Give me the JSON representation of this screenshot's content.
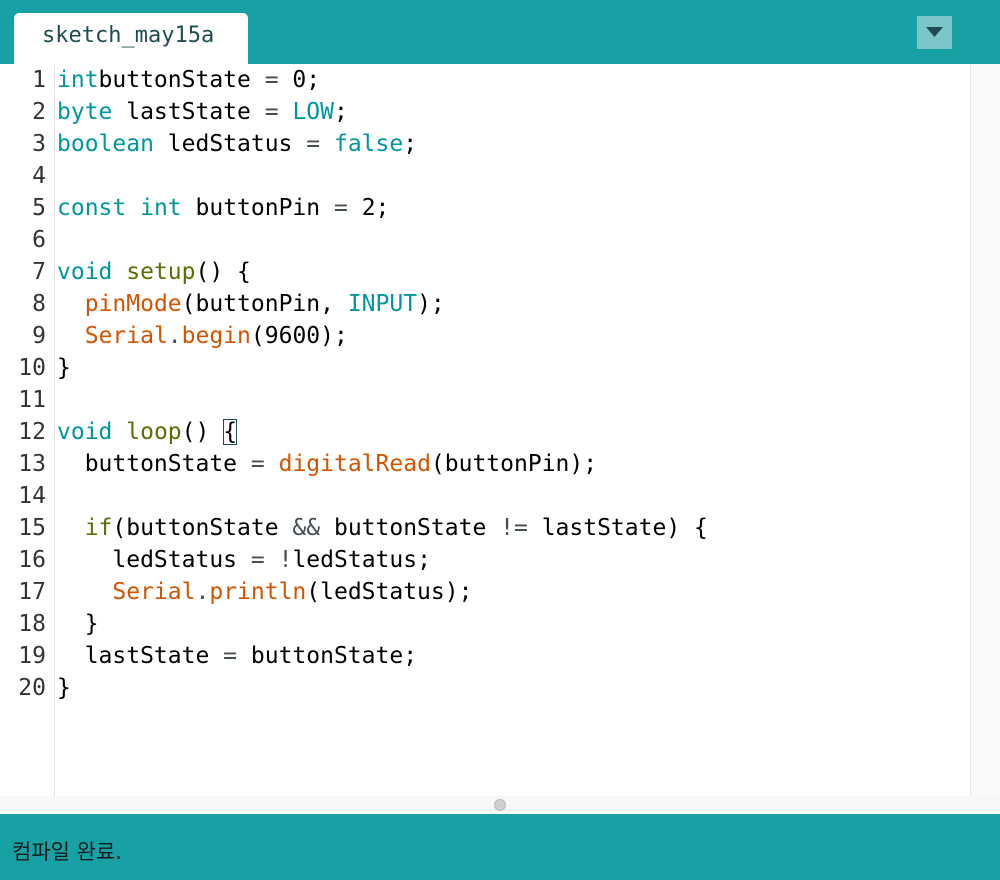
{
  "tab": {
    "label": "sketch_may15a"
  },
  "menu": {
    "icon": "triangle-down-icon"
  },
  "code": {
    "lines": [
      {
        "n": "1",
        "tokens": [
          [
            "kw",
            "int"
          ],
          [
            "",
            "buttonState "
          ],
          [
            "op",
            "="
          ],
          [
            "",
            " 0;"
          ]
        ]
      },
      {
        "n": "2",
        "tokens": [
          [
            "kw",
            "byte"
          ],
          [
            "",
            " lastState "
          ],
          [
            "op",
            "="
          ],
          [
            "",
            " "
          ],
          [
            "kw",
            "LOW"
          ],
          [
            "",
            ";"
          ]
        ]
      },
      {
        "n": "3",
        "tokens": [
          [
            "kw",
            "boolean"
          ],
          [
            "",
            " ledStatus "
          ],
          [
            "op",
            "="
          ],
          [
            "",
            " "
          ],
          [
            "kw",
            "false"
          ],
          [
            "",
            ";"
          ]
        ]
      },
      {
        "n": "4",
        "tokens": []
      },
      {
        "n": "5",
        "tokens": [
          [
            "kw",
            "const"
          ],
          [
            "",
            " "
          ],
          [
            "kw",
            "int"
          ],
          [
            "",
            " buttonPin "
          ],
          [
            "op",
            "="
          ],
          [
            "",
            " 2;"
          ]
        ]
      },
      {
        "n": "6",
        "tokens": []
      },
      {
        "n": "7",
        "tokens": [
          [
            "kw",
            "void"
          ],
          [
            "",
            " "
          ],
          [
            "fn",
            "setup"
          ],
          [
            "",
            "() {"
          ]
        ]
      },
      {
        "n": "8",
        "tokens": [
          [
            "",
            "  "
          ],
          [
            "ard",
            "pinMode"
          ],
          [
            "",
            "(buttonPin, "
          ],
          [
            "kw",
            "INPUT"
          ],
          [
            "",
            ");"
          ]
        ]
      },
      {
        "n": "9",
        "tokens": [
          [
            "",
            "  "
          ],
          [
            "ard",
            "Serial"
          ],
          [
            "op",
            "."
          ],
          [
            "ard",
            "begin"
          ],
          [
            "",
            "(9600);"
          ]
        ]
      },
      {
        "n": "10",
        "tokens": [
          [
            "",
            "}"
          ]
        ]
      },
      {
        "n": "11",
        "tokens": []
      },
      {
        "n": "12",
        "tokens": [
          [
            "kw",
            "void"
          ],
          [
            "",
            " "
          ],
          [
            "fn",
            "loop"
          ],
          [
            "",
            "() "
          ],
          [
            "cursor",
            "{"
          ]
        ]
      },
      {
        "n": "13",
        "tokens": [
          [
            "",
            "  buttonState "
          ],
          [
            "op",
            "="
          ],
          [
            "",
            " "
          ],
          [
            "ard",
            "digitalRead"
          ],
          [
            "",
            "(buttonPin);"
          ]
        ]
      },
      {
        "n": "14",
        "tokens": []
      },
      {
        "n": "15",
        "tokens": [
          [
            "",
            "  "
          ],
          [
            "fn",
            "if"
          ],
          [
            "",
            "(buttonState "
          ],
          [
            "op",
            "&&"
          ],
          [
            "",
            " buttonState "
          ],
          [
            "op",
            "!="
          ],
          [
            "",
            " lastState) {"
          ]
        ]
      },
      {
        "n": "16",
        "tokens": [
          [
            "",
            "    ledStatus "
          ],
          [
            "op",
            "="
          ],
          [
            "",
            " "
          ],
          [
            "op",
            "!"
          ],
          [
            "",
            "ledStatus;"
          ]
        ]
      },
      {
        "n": "17",
        "tokens": [
          [
            "",
            "    "
          ],
          [
            "ard",
            "Serial"
          ],
          [
            "op",
            "."
          ],
          [
            "ard",
            "println"
          ],
          [
            "",
            "(ledStatus);"
          ]
        ]
      },
      {
        "n": "18",
        "tokens": [
          [
            "",
            "  }"
          ]
        ]
      },
      {
        "n": "19",
        "tokens": [
          [
            "",
            "  lastState "
          ],
          [
            "op",
            "="
          ],
          [
            "",
            " buttonState;"
          ]
        ]
      },
      {
        "n": "20",
        "tokens": [
          [
            "",
            "}"
          ]
        ]
      }
    ]
  },
  "status": {
    "message": "컴파일 완료."
  },
  "colors": {
    "accent": "#17a1a5",
    "keyword": "#00979c",
    "function": "#5e6d03",
    "arduino": "#d35400"
  }
}
